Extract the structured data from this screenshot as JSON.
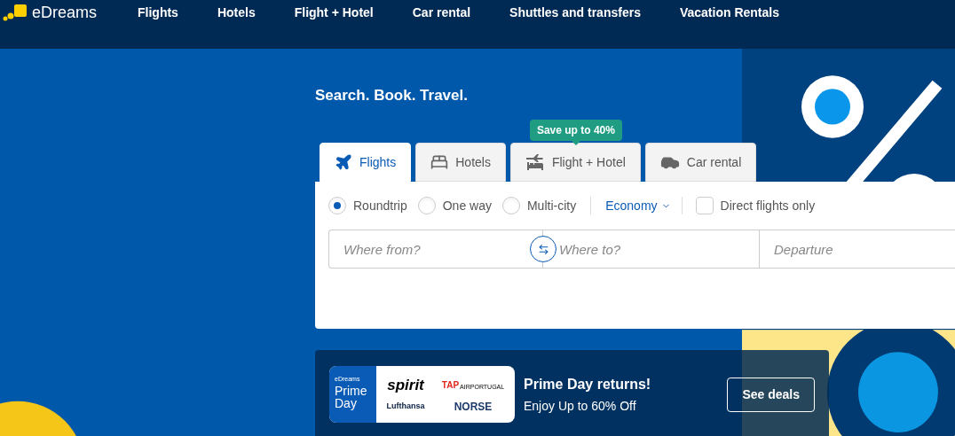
{
  "header": {
    "logo": "eDreams",
    "nav": [
      {
        "label": "Flights"
      },
      {
        "label": "Hotels"
      },
      {
        "label": "Flight + Hotel"
      },
      {
        "label": "Car rental"
      },
      {
        "label": "Shuttles and transfers"
      },
      {
        "label": "Vacation Rentals"
      }
    ]
  },
  "hero": {
    "headline": "Search. Book. Travel."
  },
  "search": {
    "promo_tooltip": "Save up to 40%",
    "tabs": [
      {
        "label": "Flights",
        "kind": "flight",
        "selected": true
      },
      {
        "label": "Hotels",
        "kind": "hotel",
        "selected": false
      },
      {
        "label": "Flight + Hotel",
        "kind": "package",
        "selected": false
      },
      {
        "label": "Car rental",
        "kind": "car",
        "selected": false
      }
    ],
    "trip_types": [
      {
        "label": "Roundtrip",
        "selected": true
      },
      {
        "label": "One way",
        "selected": false
      },
      {
        "label": "Multi-city",
        "selected": false
      }
    ],
    "cabin_class": "Economy",
    "direct_only": {
      "label": "Direct flights only",
      "checked": false
    },
    "fields": [
      {
        "placeholder": "Where from?"
      },
      {
        "placeholder": "Where to?"
      },
      {
        "placeholder": "Departure"
      }
    ]
  },
  "banner": {
    "badge": {
      "brand": "eDreams",
      "title": "Prime Day"
    },
    "airlines": {
      "spirit": "spirit",
      "tap": "TAP",
      "tap_sub": "AIRPORTUGAL",
      "lufthansa": "Lufthansa",
      "norse": "NORSE"
    },
    "title": "Prime Day returns!",
    "subtitle": "Enjoy Up to 60% Off",
    "button": "See deals"
  }
}
